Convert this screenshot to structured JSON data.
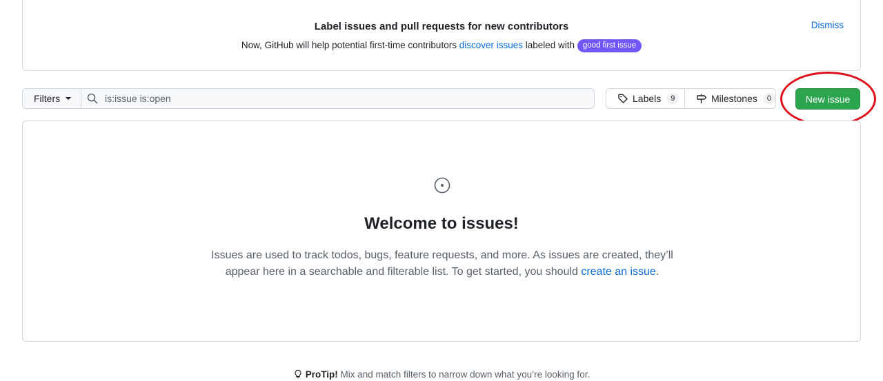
{
  "banner": {
    "title": "Label issues and pull requests for new contributors",
    "text_before": "Now, GitHub will help potential first-time contributors ",
    "link": "discover issues",
    "text_after": " labeled with ",
    "label": "good first issue",
    "label_color": "#7057ff",
    "dismiss": "Dismiss"
  },
  "filterbar": {
    "filters_label": "Filters",
    "search_value": "is:issue is:open",
    "labels_label": "Labels",
    "labels_count": "9",
    "milestones_label": "Milestones",
    "milestones_count": "0",
    "new_issue_label": "New issue",
    "new_issue_color": "#2da44e"
  },
  "blankslate": {
    "title": "Welcome to issues!",
    "text_line1": "Issues are used to track todos, bugs, feature requests, and more. As issues are created, they’ll appear here in a searchable and filterable list. To get started, you should ",
    "link": "create an issue",
    "text_end": "."
  },
  "protip": {
    "strong": "ProTip!",
    "text": " Mix and match filters to narrow down what you’re looking for."
  },
  "colors": {
    "link": "#0969da",
    "highlight": "#e0101a"
  }
}
